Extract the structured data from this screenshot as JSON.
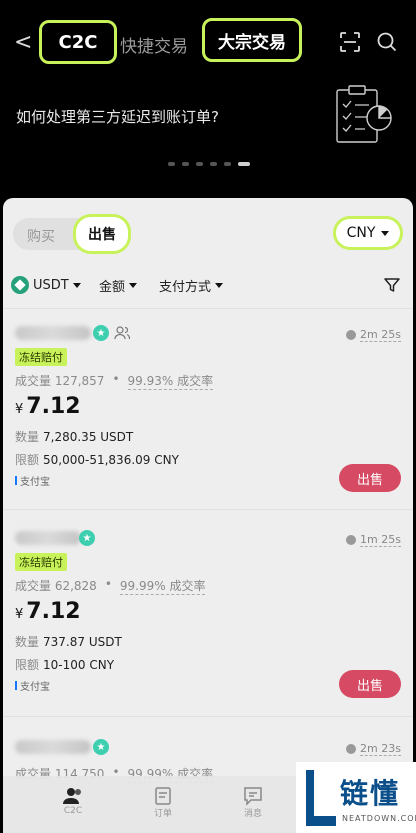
{
  "header": {
    "back_label": "<",
    "tabs": [
      "C2C",
      "快捷交易",
      "大宗交易"
    ]
  },
  "banner": {
    "text": "如何处理第三方延迟到账订单?",
    "dots_count": 6,
    "active_dot": 5
  },
  "trade": {
    "buy_label": "购买",
    "sell_label": "出售",
    "currency": "CNY"
  },
  "filters": {
    "coin": "USDT",
    "amount": "金额",
    "payment": "支付方式"
  },
  "ads": [
    {
      "timer": "2m 25s",
      "badge": "冻结赔付",
      "volume": "成交量 127,857",
      "rate": "99.93% 成交率",
      "currency_symbol": "¥",
      "price": "7.12",
      "quantity_label": "数量",
      "quantity": "7,280.35 USDT",
      "limit_label": "限额",
      "limit": "50,000-51,836.09 CNY",
      "payment": "支付宝",
      "action": "出售"
    },
    {
      "timer": "1m 25s",
      "badge": "冻结赔付",
      "volume": "成交量 62,828",
      "rate": "99.99% 成交率",
      "currency_symbol": "¥",
      "price": "7.12",
      "quantity_label": "数量",
      "quantity": "737.87 USDT",
      "limit_label": "限额",
      "limit": "10-100 CNY",
      "payment": "支付宝",
      "action": "出售"
    },
    {
      "timer": "2m 23s",
      "volume": "成交量 114,750",
      "rate": "99.99% 成交率"
    }
  ],
  "bottom_nav": {
    "items": [
      "C2C",
      "订单",
      "消息"
    ]
  },
  "watermark": {
    "cn": "链懂",
    "en": "NEATDOWN.COM"
  },
  "colors": {
    "highlight": "#c8f25a",
    "sell_button": "#d64a63",
    "verify": "#3ecfb0"
  }
}
